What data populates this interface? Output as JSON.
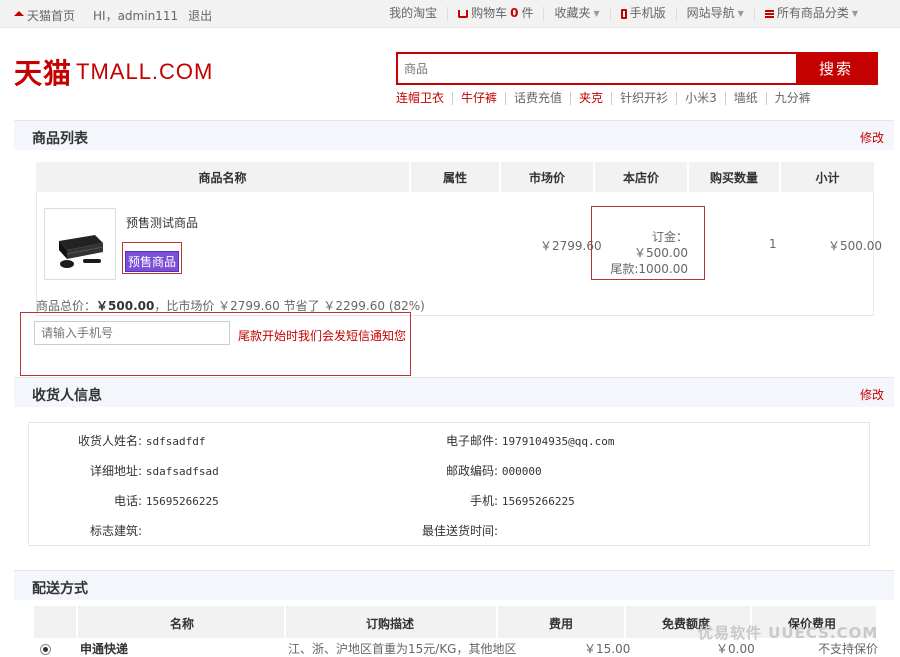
{
  "topbar": {
    "home": "天猫首页",
    "greeting": "HI，admin111",
    "logout": "退出",
    "my_taobao": "我的淘宝",
    "cart_label": "购物车",
    "cart_count": "0",
    "cart_unit": "件",
    "favorites": "收藏夹",
    "mobile": "手机版",
    "site_nav": "网站导航",
    "all_categories": "所有商品分类"
  },
  "logo": {
    "cn": "天猫",
    "en": "TMALL.COM"
  },
  "search": {
    "placeholder": "商品",
    "button": "搜索",
    "hotwords": [
      "连帽卫衣",
      "牛仔裤",
      "话费充值",
      "夹克",
      "针织开衫",
      "小米3",
      "墙纸",
      "九分裤"
    ]
  },
  "products": {
    "title": "商品列表",
    "edit": "修改",
    "headers": [
      "商品名称",
      "属性",
      "市场价",
      "本店价",
      "购买数量",
      "小计"
    ],
    "item": {
      "name": "预售测试商品",
      "tag": "预售商品",
      "market_price": "￥2799.60",
      "deposit": "订金：￥500.00",
      "balance": "尾款:1000.00",
      "quantity": "1",
      "subtotal": "￥500.00"
    },
    "summary_prefix": "商品总价：",
    "summary_total": "￥500.00",
    "summary_rest": "，比市场价 ￥2799.60 节省了 ￥2299.60 (82%)",
    "phone_placeholder": "请输入手机号",
    "phone_tip": "尾款开始时我们会发短信通知您"
  },
  "receiver": {
    "title": "收货人信息",
    "edit": "修改",
    "name_label": "收货人姓名:",
    "name_value": "sdfsadfdf",
    "email_label": "电子邮件:",
    "email_value": "1979104935@qq.com",
    "address_label": "详细地址:",
    "address_value": "sdafsadfsad",
    "zip_label": "邮政编码:",
    "zip_value": "000000",
    "tel_label": "电话:",
    "tel_value": "15695266225",
    "mobile_label": "手机:",
    "mobile_value": "15695266225",
    "landmark_label": "标志建筑:",
    "best_time_label": "最佳送货时间:"
  },
  "shipping": {
    "title": "配送方式",
    "headers": [
      "名称",
      "订购描述",
      "费用",
      "免费额度",
      "保价费用"
    ],
    "row": {
      "name": "申通快递",
      "desc": "江、浙、沪地区首重为15元/KG，其他地区",
      "fee": "￥15.00",
      "free": "￥0.00",
      "insure": "不支持保价"
    }
  },
  "watermark": "优易软件 UUECS.COM"
}
